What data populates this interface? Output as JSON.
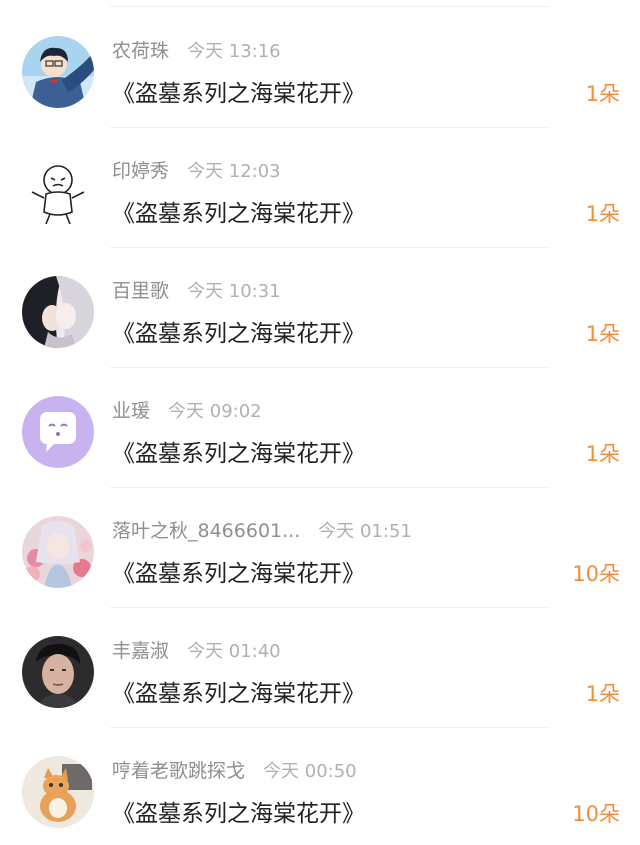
{
  "colors": {
    "accent": "#f08d3a",
    "name": "#8f8f8f",
    "time": "#b0b0b0",
    "title": "#222222"
  },
  "records": [
    {
      "name": "农荷珠",
      "time": "今天 13:16",
      "title": "《盗墓系列之海棠花开》",
      "count": "1朵",
      "avatar": "anime-boy-avatar"
    },
    {
      "name": "印婷秀",
      "time": "今天 12:03",
      "title": "《盗墓系列之海棠花开》",
      "count": "1朵",
      "avatar": "sketch-baby-avatar"
    },
    {
      "name": "百里歌",
      "time": "今天 10:31",
      "title": "《盗墓系列之海棠花开》",
      "count": "1朵",
      "avatar": "anime-couple-avatar"
    },
    {
      "name": "业瑗",
      "time": "今天 09:02",
      "title": "《盗墓系列之海棠花开》",
      "count": "1朵",
      "avatar": "chat-bubble-avatar"
    },
    {
      "name": "落叶之秋_8466601...",
      "time": "今天 01:51",
      "title": "《盗墓系列之海棠花开》",
      "count": "10朵",
      "avatar": "flower-girl-avatar"
    },
    {
      "name": "丰嘉淑",
      "time": "今天 01:40",
      "title": "《盗墓系列之海棠花开》",
      "count": "1朵",
      "avatar": "boy-photo-avatar"
    },
    {
      "name": "哼着老歌跳探戈",
      "time": "今天 00:50",
      "title": "《盗墓系列之海棠花开》",
      "count": "10朵",
      "avatar": "cat-photo-avatar"
    }
  ]
}
